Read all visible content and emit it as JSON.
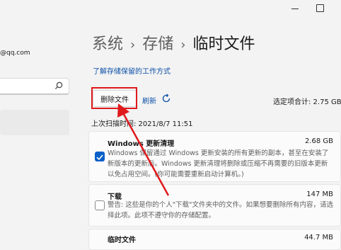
{
  "sidebar": {
    "account_email": "@qq.com"
  },
  "breadcrumb": {
    "items": [
      "系统",
      "存储",
      "临时文件"
    ],
    "separator": "›"
  },
  "link_text": "了解存储保留的工作方式",
  "toolbar": {
    "delete_label": "删除文件",
    "refresh_label": "刷新",
    "selected_total": "选定项合计: 2.75 GB"
  },
  "last_scan": "上次扫描时间: 2021/8/7 11:51",
  "items": [
    {
      "title": "Windows 更新清理",
      "size": "2.68 GB",
      "checked": true,
      "desc": "Windows 保留通过 Windows 更新安装的所有更新的副本，甚至在安装了新版本的更新后。Windows 更新清理将删除或压缩不再需要的旧版本更新以免占用空间。(你可能需要重新启动计算机。)"
    },
    {
      "title": "下载",
      "size": "147 MB",
      "checked": false,
      "desc": "警告: 这些是你的个人\"下载\"文件夹中的文件。如果想要删除所有内容，请选择此项。此项不遵守你的存储配置。"
    },
    {
      "title": "临时文件",
      "size": "44.7 MB",
      "checked": false
    }
  ],
  "colors": {
    "accent": "#0a5fc9",
    "annotation_red": "#e0191c"
  }
}
